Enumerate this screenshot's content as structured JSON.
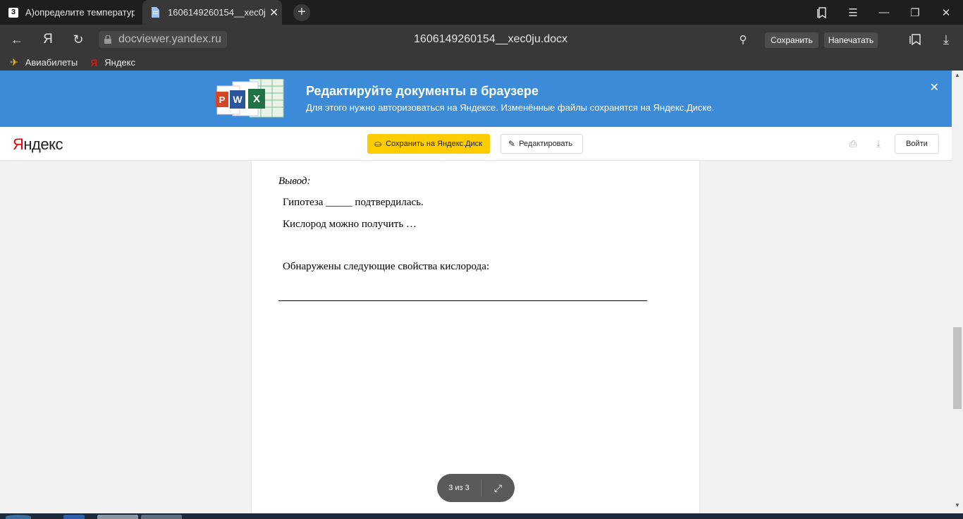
{
  "tabs": [
    {
      "favicon": "З",
      "title": "А)определите температур",
      "active": false
    },
    {
      "title": "1606149260154__xec0ju.docx",
      "active": true
    }
  ],
  "toolbar": {
    "url": "docviewer.yandex.ru",
    "title": "1606149260154__xec0ju.docx",
    "save_label": "Сохранить",
    "print_label": "Напечатать"
  },
  "bookmarks": [
    {
      "label": "Авиабилеты",
      "icon": "plane-icon"
    },
    {
      "label": "Яндекс",
      "icon": "yandex-icon"
    }
  ],
  "banner": {
    "title": "Редактируйте документы в браузере",
    "subtitle": "Для этого нужно авторизоваться на Яндексе. Изменённые файлы сохранятся на Яндекс.Диске."
  },
  "header": {
    "logo": "Яндекс",
    "save_disk_label": "Сохранить на Яндекс.Диск",
    "edit_label": "Редактировать",
    "login_label": "Войти"
  },
  "document": {
    "conclusion_label": "Вывод:",
    "line1": "Гипотеза _____ подтвердилась.",
    "line2": "Кислород можно получить …",
    "line3": "Обнаружены следующие свойства кислорода:"
  },
  "pager": {
    "label": "3 из 3"
  },
  "colors": {
    "banner_bg": "#3c8bd9",
    "save_disk_bg": "#ffcc00",
    "chrome_bg": "#383838",
    "tabbar_bg": "#1e1e1e"
  }
}
